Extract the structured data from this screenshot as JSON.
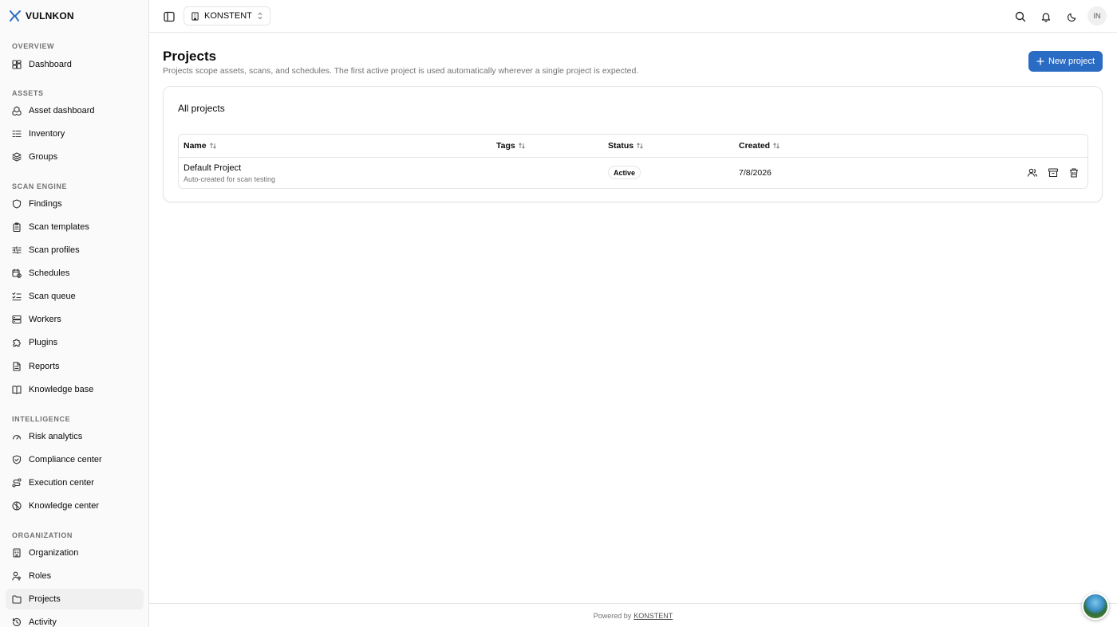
{
  "brand": {
    "name": "VULNKON",
    "accent": "#2a6cc4"
  },
  "sidebar": {
    "sections": [
      {
        "label": "OVERVIEW",
        "items": [
          {
            "label": "Dashboard",
            "icon": "dashboard-icon"
          }
        ]
      },
      {
        "label": "ASSETS",
        "items": [
          {
            "label": "Asset dashboard",
            "icon": "boxes-icon"
          },
          {
            "label": "Inventory",
            "icon": "list-icon"
          },
          {
            "label": "Groups",
            "icon": "layers-icon"
          }
        ]
      },
      {
        "label": "SCAN ENGINE",
        "items": [
          {
            "label": "Findings",
            "icon": "shield-icon"
          },
          {
            "label": "Scan templates",
            "icon": "clipboard-icon"
          },
          {
            "label": "Scan profiles",
            "icon": "sliders-icon"
          },
          {
            "label": "Schedules",
            "icon": "calendar-clock-icon"
          },
          {
            "label": "Scan queue",
            "icon": "list-checks-icon"
          },
          {
            "label": "Workers",
            "icon": "server-icon"
          },
          {
            "label": "Plugins",
            "icon": "puzzle-icon"
          },
          {
            "label": "Reports",
            "icon": "file-text-icon"
          },
          {
            "label": "Knowledge base",
            "icon": "book-icon"
          }
        ]
      },
      {
        "label": "INTELLIGENCE",
        "items": [
          {
            "label": "Risk analytics",
            "icon": "gauge-icon"
          },
          {
            "label": "Compliance center",
            "icon": "shield-check-icon"
          },
          {
            "label": "Execution center",
            "icon": "route-icon"
          },
          {
            "label": "Knowledge center",
            "icon": "brain-icon"
          }
        ]
      },
      {
        "label": "ORGANIZATION",
        "items": [
          {
            "label": "Organization",
            "icon": "building-icon"
          },
          {
            "label": "Roles",
            "icon": "user-key-icon"
          },
          {
            "label": "Projects",
            "icon": "folder-icon",
            "active": true
          },
          {
            "label": "Activity",
            "icon": "history-icon"
          }
        ]
      }
    ]
  },
  "header": {
    "org_name": "KONSTENT",
    "avatar_initials": "IN"
  },
  "page": {
    "title": "Projects",
    "description": "Projects scope assets, scans, and schedules. The first active project is used automatically wherever a single project is expected.",
    "new_button": "New project"
  },
  "card": {
    "title": "All projects",
    "columns": [
      "Name",
      "Tags",
      "Status",
      "Created"
    ],
    "rows": [
      {
        "name": "Default Project",
        "description": "Auto-created for scan testing",
        "tags": "",
        "status": "Active",
        "created": "7/8/2026"
      }
    ]
  },
  "footer": {
    "prefix": "Powered by",
    "link": "KONSTENT"
  }
}
